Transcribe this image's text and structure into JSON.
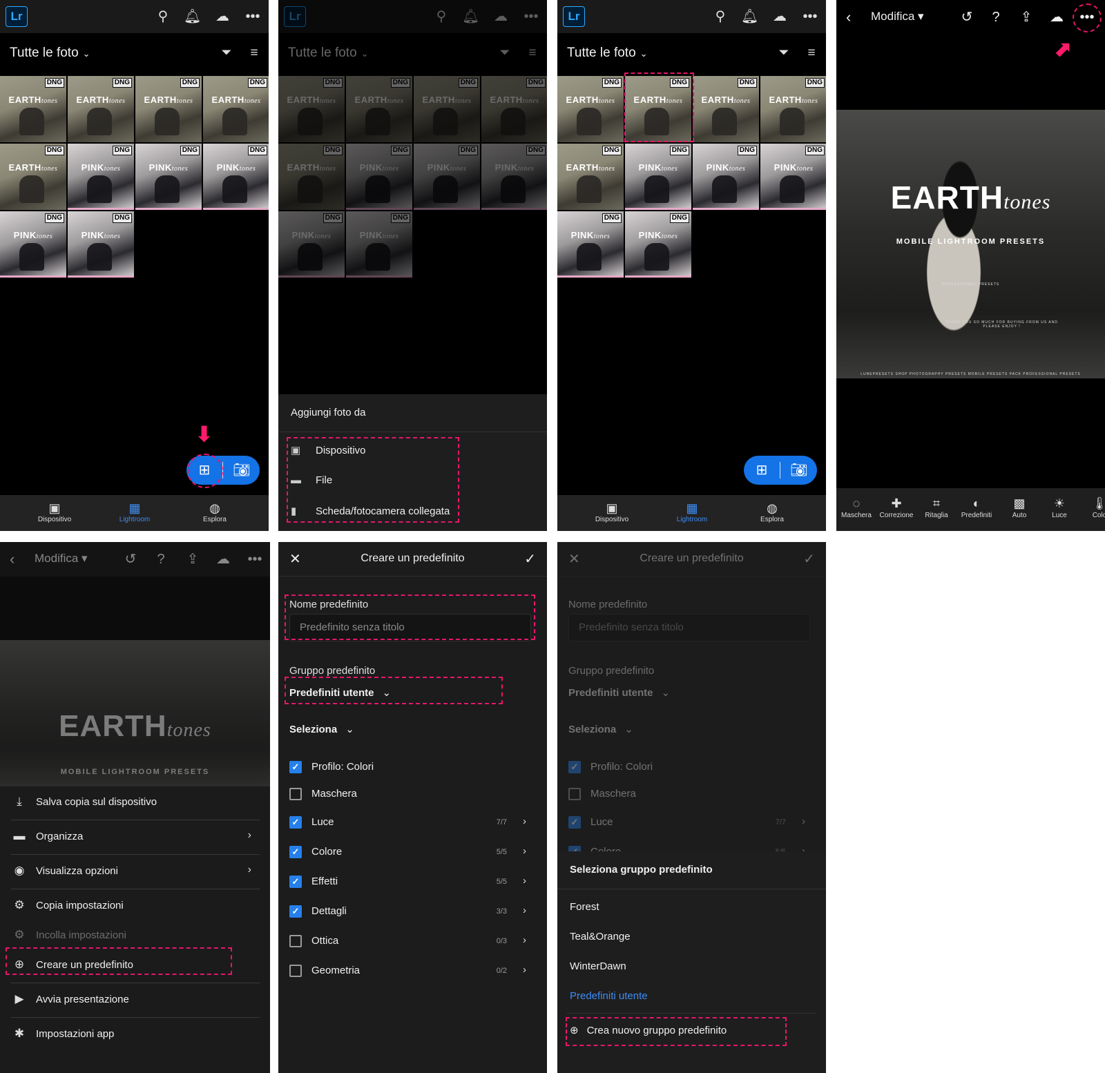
{
  "library": {
    "title": "Tutte le foto",
    "dng_badge": "DNG",
    "thumbs": [
      {
        "kind": "earth",
        "word": "EARTH",
        "script": "tones"
      },
      {
        "kind": "earth",
        "word": "EARTH",
        "script": "tones"
      },
      {
        "kind": "earth",
        "word": "EARTH",
        "script": "tones"
      },
      {
        "kind": "earth",
        "word": "EARTH",
        "script": "tones"
      },
      {
        "kind": "earth",
        "word": "EARTH",
        "script": "tones"
      },
      {
        "kind": "pink",
        "word": "PINK",
        "script": "tones"
      },
      {
        "kind": "pink",
        "word": "PINK",
        "script": "tones"
      },
      {
        "kind": "pink",
        "word": "PINK",
        "script": "tones"
      },
      {
        "kind": "pink",
        "word": "PINK",
        "script": "tones"
      },
      {
        "kind": "pink",
        "word": "PINK",
        "script": "tones"
      }
    ],
    "nav": {
      "device": "Dispositivo",
      "lightroom": "Lightroom",
      "explore": "Esplora"
    },
    "icons": [
      "search-people-icon",
      "bell-icon",
      "cloud-sync-icon",
      "more-icon",
      "filter-icon",
      "sort-icon"
    ]
  },
  "add_sheet": {
    "title": "Aggiungi foto da",
    "items": [
      "Dispositivo",
      "File",
      "Scheda/fotocamera collegata"
    ]
  },
  "editor": {
    "mode": "Modifica",
    "photo_word": "EARTH",
    "photo_script": "tones",
    "photo_sub": "MOBILE LIGHTROOM PRESETS",
    "photo_small": "PROFESSIONAL PRESETS",
    "photo_thanks": "THANK YOU SO MUCH FOR BUYING FROM US AND PLEASE ENJOY !",
    "photo_footer": "LUNEPRESETS SHOP PHOTOGRAPHY PRESETS MOBILE PRESETS PACK PROFESSIONAL PRESETS",
    "tools": [
      "Maschera",
      "Correzione",
      "Ritaglia",
      "Predefiniti",
      "Auto",
      "Luce",
      "Colo"
    ]
  },
  "menu": {
    "items": [
      {
        "label": "Salva copia sul dispositivo",
        "icon": "download-icon",
        "chevron": false,
        "disabled": false
      },
      {
        "label": "Organizza",
        "icon": "folder-icon",
        "chevron": true,
        "disabled": false
      },
      {
        "label": "Visualizza opzioni",
        "icon": "eye-icon",
        "chevron": true,
        "disabled": false
      },
      {
        "label": "Copia impostazioni",
        "icon": "copy-settings-icon",
        "chevron": false,
        "disabled": false
      },
      {
        "label": "Incolla impostazioni",
        "icon": "paste-settings-icon",
        "chevron": false,
        "disabled": true
      },
      {
        "label": "Creare un predefinito",
        "icon": "create-preset-icon",
        "chevron": false,
        "disabled": false
      },
      {
        "label": "Avvia presentazione",
        "icon": "play-icon",
        "chevron": false,
        "disabled": false
      },
      {
        "label": "Impostazioni app",
        "icon": "gear-icon",
        "chevron": false,
        "disabled": false
      }
    ]
  },
  "preset_form": {
    "title": "Creare un predefinito",
    "name_label": "Nome predefinito",
    "name_placeholder": "Predefinito senza titolo",
    "group_label": "Gruppo predefinito",
    "group_value": "Predefiniti utente",
    "select_label": "Seleziona",
    "options": [
      {
        "label": "Profilo: Colori",
        "checked": true,
        "count": ""
      },
      {
        "label": "Maschera",
        "checked": false,
        "count": ""
      },
      {
        "label": "Luce",
        "checked": true,
        "count": "7/7"
      },
      {
        "label": "Colore",
        "checked": true,
        "count": "5/5"
      },
      {
        "label": "Effetti",
        "checked": true,
        "count": "5/5"
      },
      {
        "label": "Dettagli",
        "checked": true,
        "count": "3/3"
      },
      {
        "label": "Ottica",
        "checked": false,
        "count": "0/3"
      },
      {
        "label": "Geometria",
        "checked": false,
        "count": "0/2"
      }
    ]
  },
  "group_sheet": {
    "title": "Seleziona gruppo predefinito",
    "groups": [
      "Forest",
      "Teal&Orange",
      "WinterDawn",
      "Predefiniti utente"
    ],
    "create": "Crea nuovo gruppo predefinito"
  },
  "colors": {
    "accent": "#1473e6",
    "highlight": "#e8166a",
    "checkbox": "#2680eb"
  }
}
